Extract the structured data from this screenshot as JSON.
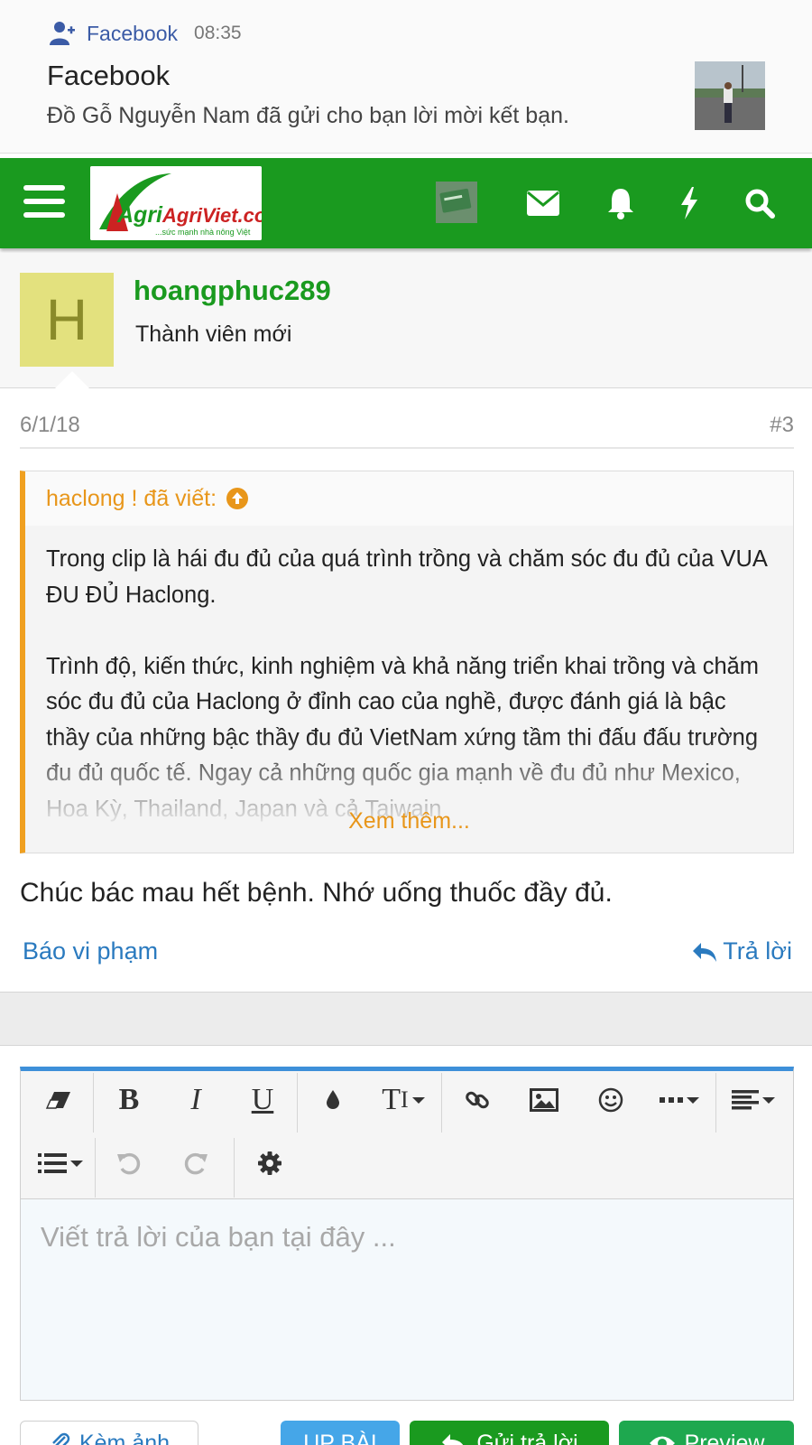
{
  "notification": {
    "app_name": "Facebook",
    "time": "08:35",
    "title": "Facebook",
    "body": "Đồ Gỗ Nguyễn Nam đã gửi cho bạn lời mời kết bạn."
  },
  "navbar": {
    "logo_text": "AgriViet.com",
    "logo_tagline": "...sức mạnh nhà nông Việt",
    "icons": [
      "menu-icon",
      "envelope-icon",
      "bell-icon",
      "bolt-icon",
      "search-icon"
    ]
  },
  "profile": {
    "avatar_letter": "H",
    "username": "hoangphuc289",
    "title": "Thành viên mới"
  },
  "post": {
    "date": "6/1/18",
    "number": "#3",
    "quote": {
      "author": "haclong ! đã viết:",
      "paragraph1": "Trong clip là hái đu đủ của quá trình trồng và chăm sóc đu đủ của VUA ĐU ĐỦ Haclong.",
      "paragraph2": "Trình độ, kiến thức, kinh nghiệm và khả năng triển khai trồng và chăm sóc đu đủ của Haclong ở đỉnh cao của nghề, được đánh giá là bậc thầy của những bậc thầy đu đủ VietNam xứng tầm thi đấu đấu trường đu đủ quốc tế. Ngay cả những quốc gia mạnh về đu đủ như Mexico, Hoa Kỳ, Thailand, Japan và cả Taiwain",
      "more": "Xem thêm..."
    },
    "text": "Chúc bác mau hết bệnh. Nhớ uống thuốc đầy đủ.",
    "report_label": "Báo vi phạm",
    "reply_label": "Trả lời"
  },
  "editor": {
    "placeholder": "Viết trả lời của bạn tại đây ..."
  },
  "buttons": {
    "attach": "Kèm ảnh",
    "up": "UP BÀI",
    "send": "Gửi trả lời",
    "preview": "Preview"
  },
  "colors": {
    "brand_green": "#1a9a1f",
    "link_blue": "#2a7abf",
    "quote_orange": "#e8961a",
    "editor_accent": "#3d8fd9"
  }
}
